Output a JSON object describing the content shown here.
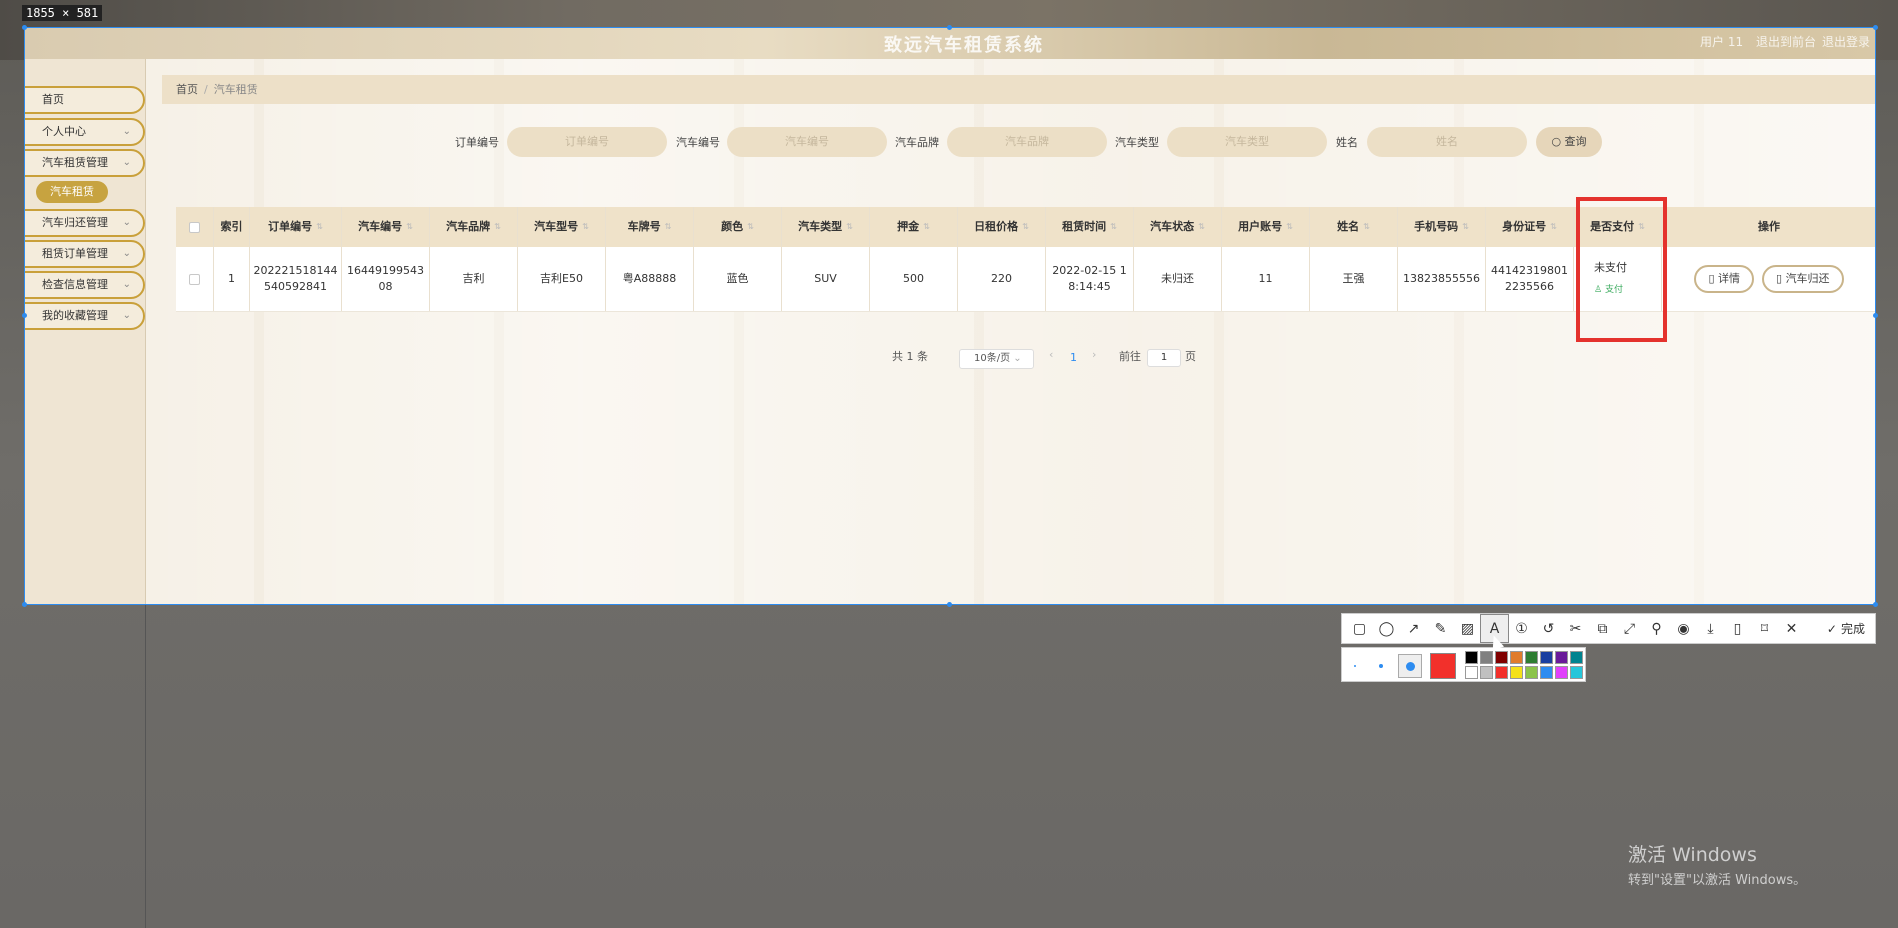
{
  "screenshot": {
    "size_label": "1855 × 581"
  },
  "header": {
    "title": "致远汽车租赁系统",
    "user": "用户 11",
    "link1": "退出到前台",
    "link2": "退出登录"
  },
  "sidebar": {
    "items": [
      {
        "label": "首页"
      },
      {
        "label": "个人中心"
      },
      {
        "label": "汽车租赁管理"
      },
      {
        "label": "汽车归还管理"
      },
      {
        "label": "租赁订单管理"
      },
      {
        "label": "检查信息管理"
      },
      {
        "label": "我的收藏管理"
      }
    ],
    "active_sub": "汽车租赁"
  },
  "breadcrumb": {
    "home": "首页",
    "current": "汽车租赁"
  },
  "search": {
    "fields": [
      {
        "label": "订单编号",
        "placeholder": "订单编号"
      },
      {
        "label": "汽车编号",
        "placeholder": "汽车编号"
      },
      {
        "label": "汽车品牌",
        "placeholder": "汽车品牌"
      },
      {
        "label": "汽车类型",
        "placeholder": "汽车类型"
      },
      {
        "label": "姓名",
        "placeholder": "姓名"
      }
    ],
    "button": "查询"
  },
  "table": {
    "headers": [
      "索引",
      "订单编号",
      "汽车编号",
      "汽车品牌",
      "汽车型号",
      "车牌号",
      "颜色",
      "汽车类型",
      "押金",
      "日租价格",
      "租赁时间",
      "汽车状态",
      "用户账号",
      "姓名",
      "手机号码",
      "身份证号",
      "是否支付",
      "操作"
    ],
    "row": {
      "index": "1",
      "order_no_1": "202221518144",
      "order_no_2": "540592841",
      "car_no_1": "16449199543",
      "car_no_2": "08",
      "brand": "吉利",
      "model": "吉利E50",
      "plate": "粤A88888",
      "color": "蓝色",
      "type": "SUV",
      "deposit": "500",
      "daily_price": "220",
      "rent_time_1": "2022-02-15 1",
      "rent_time_2": "8:14:45",
      "status": "未归还",
      "account": "11",
      "name": "王强",
      "phone": "13823855556",
      "id_no_1": "44142319801",
      "id_no_2": "2235566",
      "paid": "未支付",
      "pay_link": "支付",
      "detail_btn": "详情",
      "return_btn": "汽车归还"
    }
  },
  "pager": {
    "total": "共 1 条",
    "page_size": "10条/页",
    "current": "1",
    "goto_prefix": "前往",
    "goto_value": "1",
    "goto_suffix": "页"
  },
  "toolbar": {
    "done": "完成"
  },
  "colors": {
    "accent": "#c7a340",
    "highlight": "#e4322d",
    "current_color": "#f2302b"
  },
  "watermark": {
    "line1": "激活 Windows",
    "line2": "转到\"设置\"以激活 Windows。"
  }
}
